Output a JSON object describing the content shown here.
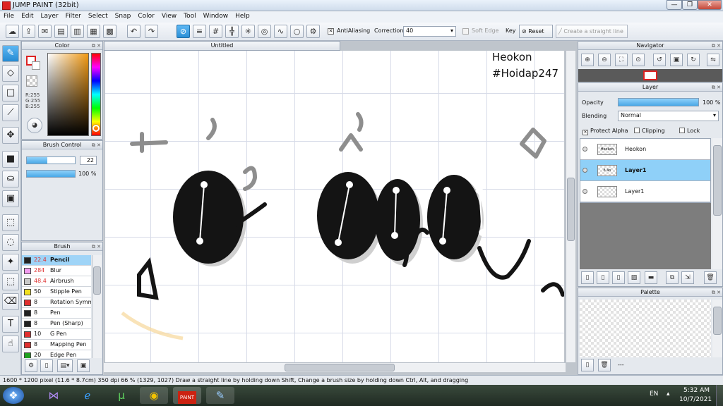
{
  "window": {
    "title": "JUMP PAINT (32bit)",
    "min": "—",
    "max": "❐",
    "close": "✕"
  },
  "menu": [
    "File",
    "Edit",
    "Layer",
    "Filter",
    "Select",
    "Snap",
    "Color",
    "View",
    "Tool",
    "Window",
    "Help"
  ],
  "toolbar": {
    "antialiasing_label": "AntiAliasing",
    "correction_label": "Correction",
    "correction_value": "40",
    "soft_edge_label": "Soft Edge",
    "key_label": "Key",
    "reset_label": "Reset",
    "straight_line_label": "Create a straight line"
  },
  "color_panel": {
    "title": "Color",
    "r": "R:255",
    "g": "G:255",
    "b": "B:255"
  },
  "brush_control": {
    "title": "Brush Control",
    "size": "22",
    "opacity": "100 %",
    "size_fill": 0.42,
    "opacity_fill": 1.0
  },
  "brush_panel": {
    "title": "Brush",
    "items": [
      {
        "size": "22.4",
        "name": "Pencil",
        "color": "#222222",
        "selected": true
      },
      {
        "size": "284",
        "name": "Blur",
        "color": "#f19cf0",
        "selected": false
      },
      {
        "size": "48.4",
        "name": "Airbrush",
        "color": "#c8c8c8",
        "selected": false
      },
      {
        "size": "50",
        "name": "Stipple Pen",
        "color": "#f0e020",
        "selected": false
      },
      {
        "size": "8",
        "name": "Rotation Symm",
        "color": "#e03030",
        "selected": false
      },
      {
        "size": "8",
        "name": "Pen",
        "color": "#222222",
        "selected": false
      },
      {
        "size": "8",
        "name": "Pen (Sharp)",
        "color": "#222222",
        "selected": false
      },
      {
        "size": "10",
        "name": "G Pen",
        "color": "#e03030",
        "selected": false
      },
      {
        "size": "8",
        "name": "Mapping Pen",
        "color": "#e03030",
        "selected": false
      },
      {
        "size": "20",
        "name": "Edge Pen",
        "color": "#20a020",
        "selected": false
      }
    ]
  },
  "canvas": {
    "tab_title": "Untitled",
    "watermark_line1": "Heokon",
    "watermark_line2": "#Hoidap247"
  },
  "navigator": {
    "title": "Navigator"
  },
  "layer_panel": {
    "title": "Layer",
    "opacity_label": "Opacity",
    "opacity_value": "100 %",
    "blending_label": "Blending",
    "blending_value": "Normal",
    "protect_alpha": "Protect Alpha",
    "clipping": "Clipping",
    "lock": "Lock",
    "layers": [
      {
        "name": "Heokon",
        "selected": false,
        "bold": false
      },
      {
        "name": "Layer1",
        "selected": true,
        "bold": true
      },
      {
        "name": "Layer1",
        "selected": false,
        "bold": false
      }
    ]
  },
  "palette": {
    "title": "Palette",
    "dash": "---"
  },
  "status": {
    "text": "1600 * 1200 pixel   (11.6 * 8.7cm)   350 dpi   66 %   (1329, 1027)   Draw a straight line by holding down Shift, Change a brush size by holding down Ctrl, Alt, and dragging"
  },
  "taskbar": {
    "lang": "EN",
    "time": "5:32 AM",
    "date": "10/7/2021",
    "paint_label": "PAINT"
  }
}
